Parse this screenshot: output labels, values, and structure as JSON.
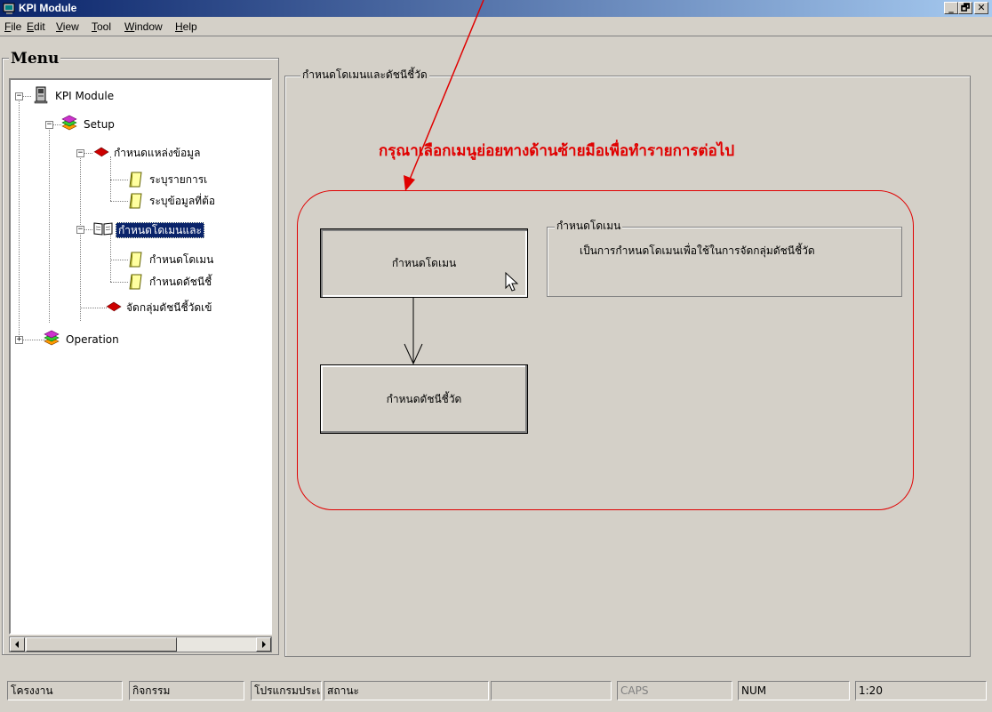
{
  "window": {
    "title": "KPI Module",
    "controls": [
      "_",
      "🗗",
      "✕"
    ]
  },
  "menubar": [
    {
      "label": "File",
      "accel": "F",
      "rest": "ile"
    },
    {
      "label": "Edit",
      "accel": "E",
      "rest": "dit"
    },
    {
      "label": "View",
      "accel": "V",
      "rest": "iew"
    },
    {
      "label": "Tool",
      "accel": "T",
      "rest": "ool"
    },
    {
      "label": "Window",
      "accel": "W",
      "rest": "indow"
    },
    {
      "label": "Help",
      "accel": "H",
      "rest": "elp"
    }
  ],
  "sidebar": {
    "heading": "Menu",
    "tree": {
      "root": "KPI Module",
      "setup": "Setup",
      "data_source": "กำหนดแหล่งข้อมูล",
      "data_source_item1": "ระบุรายการเ",
      "data_source_item2": "ระบุข้อมูลที่ต้อ",
      "domain_index": "กำหนดโดเมนและ",
      "domain_item": "กำหนดโดเมน",
      "index_item": "กำหนดดัชนีชี้",
      "group_index": "จัดกลุ่มดัชนีชี้วัดเข้",
      "operation": "Operation"
    },
    "expanders": {
      "minus": "−",
      "plus": "+"
    }
  },
  "main": {
    "group_title": "กำหนดโดเมนและดัชนีชี้วัด",
    "instruction": "กรุณาเลือกเมนูย่อยทางด้านซ้ายมือเพื่อทำรายการต่อไป",
    "buttons": {
      "domain": "กำหนดโดเมน",
      "index": "กำหนดดัชนีชี้วัด"
    },
    "description": {
      "title": "กำหนดโดเมน",
      "text": "เป็นการกำหนดโดเมนเพื่อใช้ในการจัดกลุ่มดัชนีชี้วัด"
    }
  },
  "statusbar": {
    "project": "โครงงาน",
    "activity": "กิจกรรม",
    "program_type": "โปรแกรมประเภท",
    "status": "สถานะ",
    "empty": "",
    "caps": "CAPS",
    "num": "NUM",
    "time": "1:20"
  },
  "colors": {
    "accent_red": "#e00000",
    "titlebar_start": "#0a246a",
    "titlebar_end": "#a6caf0",
    "face": "#d4d0c8"
  }
}
